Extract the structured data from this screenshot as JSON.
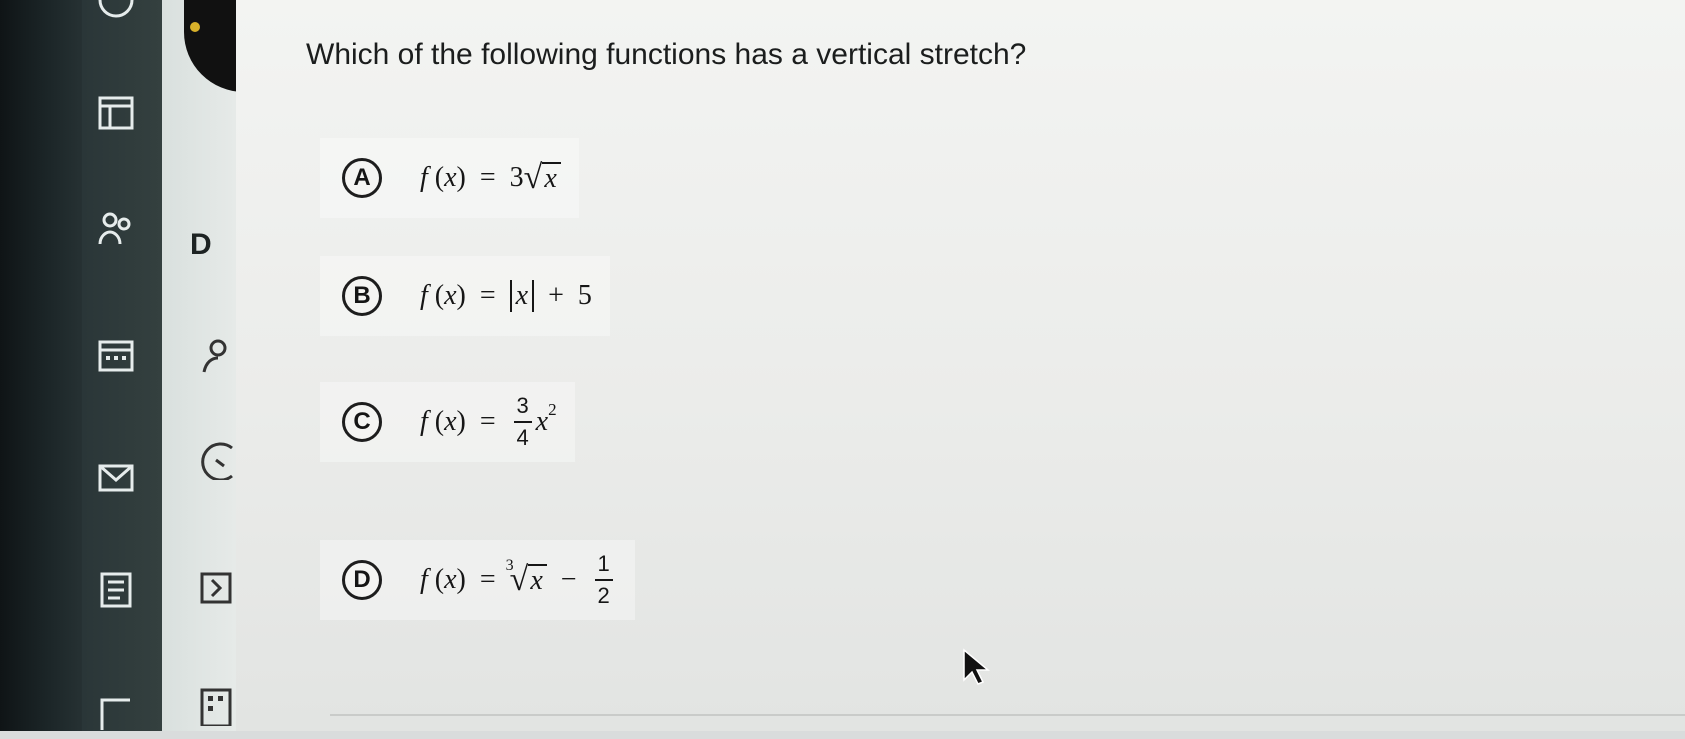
{
  "question": {
    "text": "Which of the following functions has a vertical stretch?"
  },
  "choices": [
    {
      "letter": "A",
      "fn": "f",
      "var": "x",
      "eq": "=",
      "coef": "3",
      "radicand": "x"
    },
    {
      "letter": "B",
      "fn": "f",
      "var": "x",
      "eq": "=",
      "abs_var": "x",
      "op": "+",
      "constant": "5"
    },
    {
      "letter": "C",
      "fn": "f",
      "var": "x",
      "eq": "=",
      "num": "3",
      "den": "4",
      "base": "x",
      "exp": "2"
    },
    {
      "letter": "D",
      "fn": "f",
      "var": "x",
      "eq": "=",
      "root_index": "3",
      "radicand": "x",
      "op": "−",
      "num": "1",
      "den": "2"
    }
  ],
  "subnav": {
    "letter": "D"
  },
  "icons": {
    "rail": [
      "top-circle-icon",
      "board-icon",
      "people-icon",
      "calendar-icon",
      "mail-icon",
      "document-icon",
      "corner-icon"
    ],
    "subnav": [
      "person-icon",
      "clock-icon",
      "chevron-right-icon",
      "keyboard-icon"
    ]
  },
  "colors": {
    "sidebar": "#1c2628",
    "panel": "#f3f4f2",
    "text": "#1b1d1d",
    "accent_dot": "#d8b12a"
  }
}
